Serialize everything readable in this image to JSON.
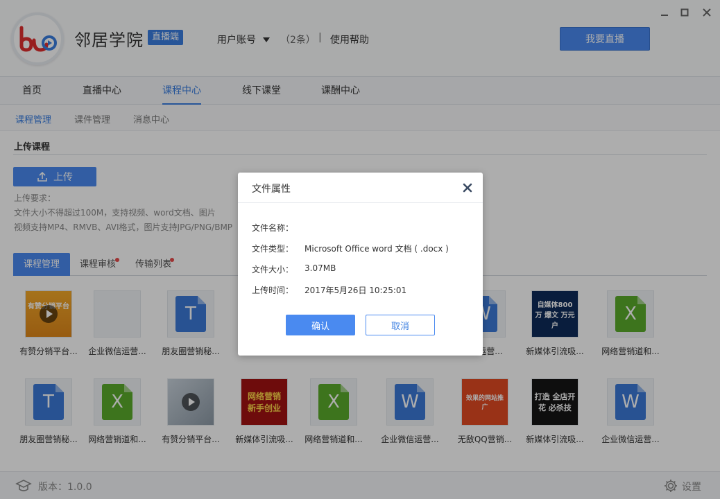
{
  "header": {
    "app_name": "邻居学院",
    "badge": "直播端",
    "account": "用户账号",
    "account_count": "（2条）",
    "separator": "|",
    "help": "使用帮助",
    "live_button": "我要直播"
  },
  "nav": {
    "items": [
      {
        "label": "首页"
      },
      {
        "label": "直播中心"
      },
      {
        "label": "课程中心"
      },
      {
        "label": "线下课堂"
      },
      {
        "label": "课酬中心"
      }
    ],
    "active": "课程中心"
  },
  "subnav": {
    "items": [
      {
        "label": "课程管理"
      },
      {
        "label": "课件管理"
      },
      {
        "label": "消息中心"
      }
    ],
    "active": "课程管理"
  },
  "upload": {
    "section_title": "上传课程",
    "button": "上传",
    "requirements": [
      "上传要求：",
      "文件大小不得超过100M，支持视频、word文档、图片",
      "视频支持MP4、RMVB、AVI格式，图片支持JPG/PNG/BMP"
    ]
  },
  "tabs": [
    {
      "label": "课程管理",
      "active": true
    },
    {
      "label": "课程审核",
      "dot": true
    },
    {
      "label": "传输列表",
      "dot": true
    }
  ],
  "files_row1": [
    {
      "label": "有赞分销平台...",
      "kind": "video",
      "thumb_text": "有赞分销平台"
    },
    {
      "label": "企业微信运营...",
      "kind": "blank"
    },
    {
      "label": "朋友圈营销秘...",
      "kind": "word",
      "letter": "T"
    },
    {
      "label": "微信运营...",
      "kind": "word",
      "letter": "W"
    },
    {
      "label": "新媒体引流吸...",
      "kind": "image",
      "thumb_text": "自媒体800万 爆文 万元户"
    },
    {
      "label": "网络营销道和...",
      "kind": "excel",
      "letter": "X"
    }
  ],
  "files_row2": [
    {
      "label": "朋友圈营销秘...",
      "kind": "word",
      "letter": "T"
    },
    {
      "label": "网络营销道和...",
      "kind": "excel",
      "letter": "X"
    },
    {
      "label": "有赞分销平台...",
      "kind": "video"
    },
    {
      "label": "新媒体引流吸...",
      "kind": "image",
      "thumb_text": "网络营销 新手创业"
    },
    {
      "label": "网络营销道和...",
      "kind": "excel",
      "letter": "X"
    },
    {
      "label": "企业微信运营...",
      "kind": "word",
      "letter": "W"
    },
    {
      "label": "无敌QQ营销...",
      "kind": "image",
      "thumb_text": "效果的网站推广"
    },
    {
      "label": "新媒体引流吸...",
      "kind": "image",
      "thumb_text": "打造 全店开花 必杀技"
    },
    {
      "label": "企业微信运营...",
      "kind": "word",
      "letter": "W"
    }
  ],
  "footer": {
    "version": "版本：1.0.0",
    "settings": "设置"
  },
  "dialog": {
    "title": "文件属性",
    "fields": [
      {
        "label": "文件名称：",
        "value": ""
      },
      {
        "label": "文件类型：",
        "value": "Microsoft Office word 文档 ( .docx )"
      },
      {
        "label": "文件大小：",
        "value": "3.07MB"
      },
      {
        "label": "上传时间：",
        "value": "2017年5月26日  10:25:01"
      }
    ],
    "ok": "确认",
    "cancel": "取消"
  },
  "colors": {
    "accent": "#4a8af0",
    "word": "#3b7ad8",
    "excel": "#5aac2c",
    "dot": "#e84a4a"
  }
}
